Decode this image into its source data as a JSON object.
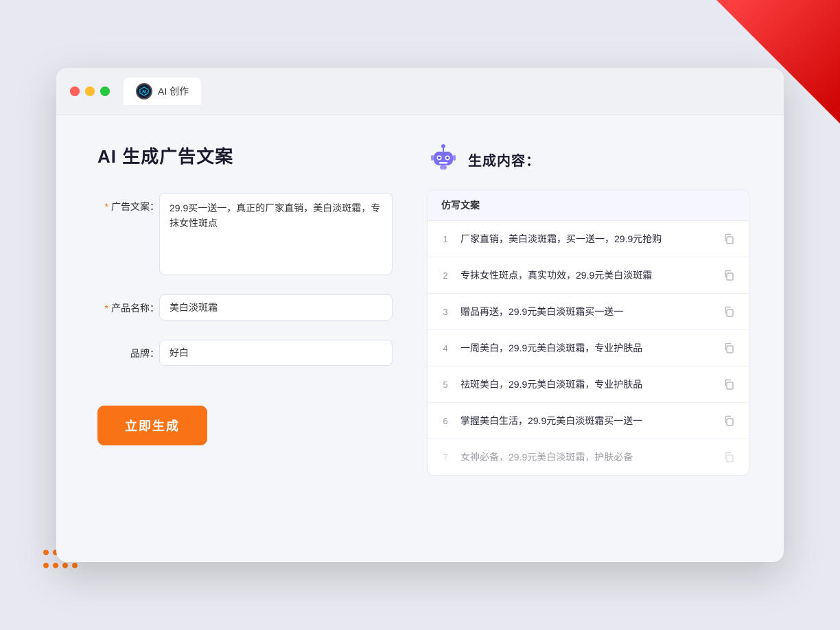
{
  "window": {
    "tab_label": "AI 创作",
    "traffic_lights": [
      "red",
      "yellow",
      "green"
    ]
  },
  "left_panel": {
    "title": "AI 生成广告文案",
    "form": {
      "ad_copy_label": "广告文案：",
      "ad_copy_required": true,
      "ad_copy_value": "29.9买一送一，真正的厂家直销，美白淡斑霜，专抹女性斑点",
      "product_name_label": "产品名称：",
      "product_name_required": true,
      "product_name_value": "美白淡斑霜",
      "brand_label": "品牌：",
      "brand_required": false,
      "brand_value": "好白"
    },
    "generate_button": "立即生成"
  },
  "right_panel": {
    "title": "生成内容：",
    "table_header": "仿写文案",
    "results": [
      {
        "num": "1",
        "text": "厂家直销，美白淡斑霜，买一送一，29.9元抢购",
        "muted": false
      },
      {
        "num": "2",
        "text": "专抹女性斑点，真实功效，29.9元美白淡斑霜",
        "muted": false
      },
      {
        "num": "3",
        "text": "赠品再送，29.9元美白淡斑霜买一送一",
        "muted": false
      },
      {
        "num": "4",
        "text": "一周美白，29.9元美白淡斑霜，专业护肤品",
        "muted": false
      },
      {
        "num": "5",
        "text": "祛斑美白，29.9元美白淡斑霜，专业护肤品",
        "muted": false
      },
      {
        "num": "6",
        "text": "掌握美白生活，29.9元美白淡斑霜买一送一",
        "muted": false
      },
      {
        "num": "7",
        "text": "女神必备，29.9元美白淡斑霜，护肤必备",
        "muted": true
      }
    ]
  },
  "colors": {
    "orange": "#f97316",
    "purple": "#7c6ff7",
    "dark": "#1a1a2e"
  }
}
